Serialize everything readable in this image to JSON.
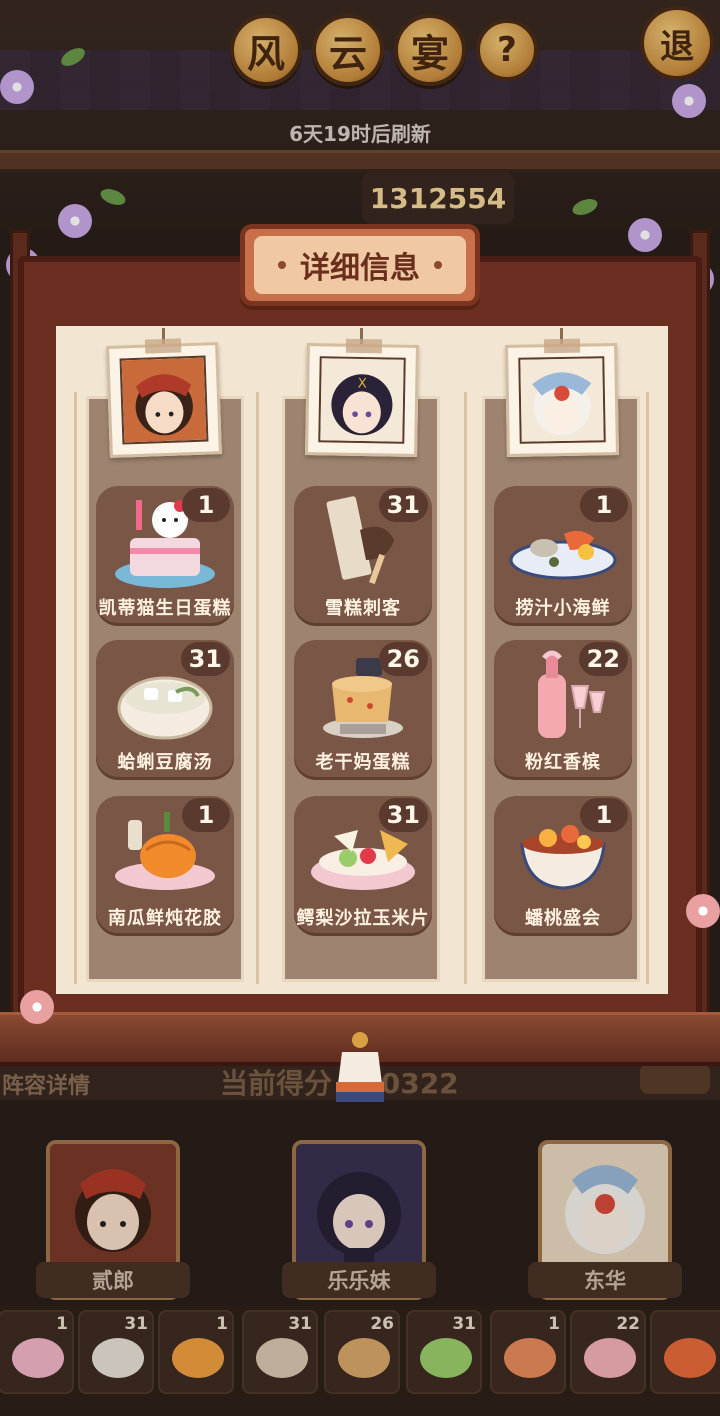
{
  "header": {
    "title_chars": [
      "风",
      "云",
      "宴"
    ],
    "help_label": "?",
    "exit_label": "退",
    "refresh_text": "6天19时后刷新",
    "score": "1312554"
  },
  "modal": {
    "title": "详细信息",
    "columns": [
      {
        "hero": "贰郎",
        "dishes": [
          {
            "name": "凯蒂猫生日蛋糕",
            "count": "1"
          },
          {
            "name": "蛤蜊豆腐汤",
            "count": "31"
          },
          {
            "name": "南瓜鲜炖花胶",
            "count": "1"
          }
        ]
      },
      {
        "hero": "乐乐妹",
        "dishes": [
          {
            "name": "雪糕刺客",
            "count": "31"
          },
          {
            "name": "老干妈蛋糕",
            "count": "26"
          },
          {
            "name": "鳄梨沙拉玉米片",
            "count": "31"
          }
        ]
      },
      {
        "hero": "东华",
        "dishes": [
          {
            "name": "捞汁小海鲜",
            "count": "1"
          },
          {
            "name": "粉红香槟",
            "count": "22"
          },
          {
            "name": "蟠桃盛会",
            "count": "1"
          }
        ]
      }
    ]
  },
  "bottom": {
    "lineup_label": "阵容详情",
    "current_score_label": "当前得分",
    "current_score_value": "580322",
    "heroes": [
      "贰郎",
      "乐乐妹",
      "东华"
    ],
    "strip_counts": [
      "1",
      "31",
      "1",
      "31",
      "26",
      "31",
      "1",
      "22",
      ""
    ]
  },
  "colors": {
    "frame": "#6b2f22",
    "panel": "#f2e6d2",
    "card": "#7a5646",
    "plaque": "#c7704a"
  }
}
